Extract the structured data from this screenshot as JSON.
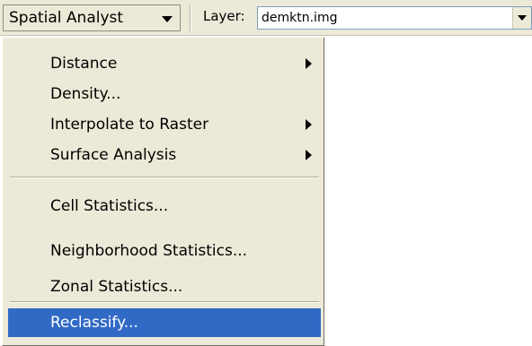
{
  "toolbar": {
    "spatial_analyst_label": "Spatial Analyst",
    "layer_label": "Layer:",
    "layer_value": "demktn.img"
  },
  "menu": {
    "items": [
      {
        "label": "Distance",
        "has_submenu": true
      },
      {
        "label": "Density...",
        "has_submenu": false
      },
      {
        "label": "Interpolate to Raster",
        "has_submenu": true
      },
      {
        "label": "Surface Analysis",
        "has_submenu": true
      },
      {
        "label": "Cell Statistics...",
        "has_submenu": false
      },
      {
        "label": "Neighborhood Statistics...",
        "has_submenu": false
      },
      {
        "label": "Zonal Statistics...",
        "has_submenu": false
      },
      {
        "label": "Reclassify...",
        "has_submenu": false,
        "selected": true
      }
    ]
  },
  "colors": {
    "menu_background": "#ece9d8",
    "selection_background": "#316ac5",
    "selection_text": "#ffffff"
  }
}
